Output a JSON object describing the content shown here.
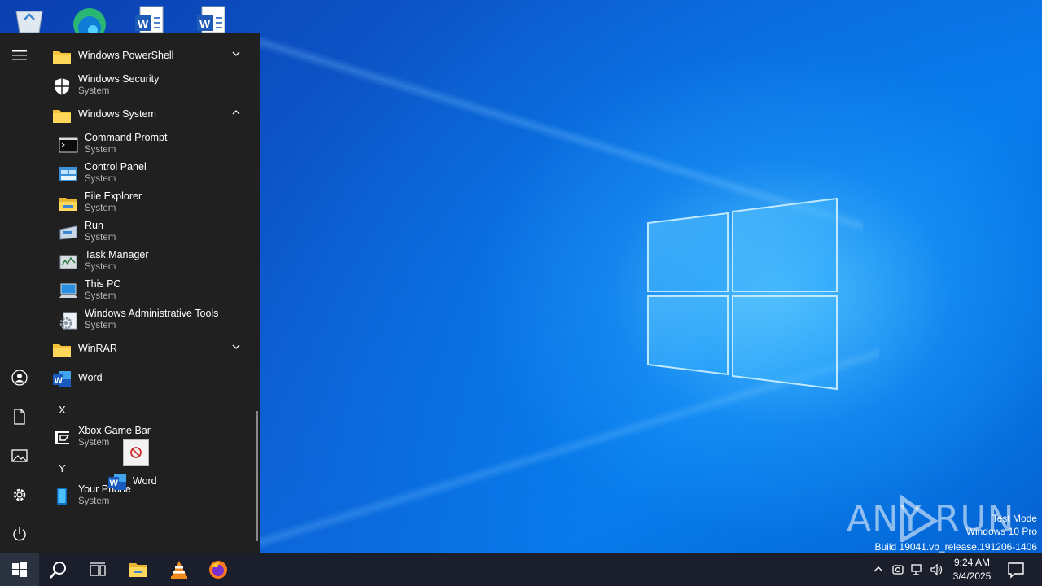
{
  "desktop": {
    "icons": [
      "recycle-bin-icon",
      "edge-icon",
      "word-document-icon",
      "word-document-icon"
    ]
  },
  "start_menu": {
    "rail": [
      "hamburger-icon",
      "user-icon",
      "documents-icon",
      "pictures-icon",
      "settings-icon",
      "power-icon"
    ],
    "items": [
      {
        "label": "Windows PowerShell",
        "kind": "folder",
        "expanded": false
      },
      {
        "label": "Windows Security",
        "sub": "System"
      },
      {
        "label": "Windows System",
        "kind": "folder",
        "expanded": true
      },
      {
        "label": "Command Prompt",
        "sub": "System"
      },
      {
        "label": "Control Panel",
        "sub": "System"
      },
      {
        "label": "File Explorer",
        "sub": "System"
      },
      {
        "label": "Run",
        "sub": "System"
      },
      {
        "label": "Task Manager",
        "sub": "System"
      },
      {
        "label": "This PC",
        "sub": "System"
      },
      {
        "label": "Windows Administrative Tools",
        "sub": "System"
      },
      {
        "label": "WinRAR",
        "kind": "folder",
        "expanded": false
      },
      {
        "label": "Word"
      },
      {
        "label": "Xbox Game Bar",
        "sub": "System"
      },
      {
        "label": "Your Phone",
        "sub": "System"
      }
    ],
    "letters": {
      "x": "X",
      "y": "Y"
    }
  },
  "drag": {
    "label": "Word",
    "cursor": "no-drop-icon"
  },
  "watermark": {
    "brand": "ANY RUN",
    "mode": "Test Mode",
    "edition": "Windows 10 Pro",
    "build": "Build 19041.vb_release.191206-1406"
  },
  "taskbar": {
    "apps": [
      "start-icon",
      "search-icon",
      "task-view-icon",
      "file-explorer-icon",
      "vlc-icon",
      "firefox-icon"
    ],
    "time": "9:24 AM",
    "date": "3/4/2025"
  },
  "colors": {
    "accent": "#0078d7",
    "menu_bg": "#202020",
    "taskbar_bg": "#1a1f2b"
  }
}
